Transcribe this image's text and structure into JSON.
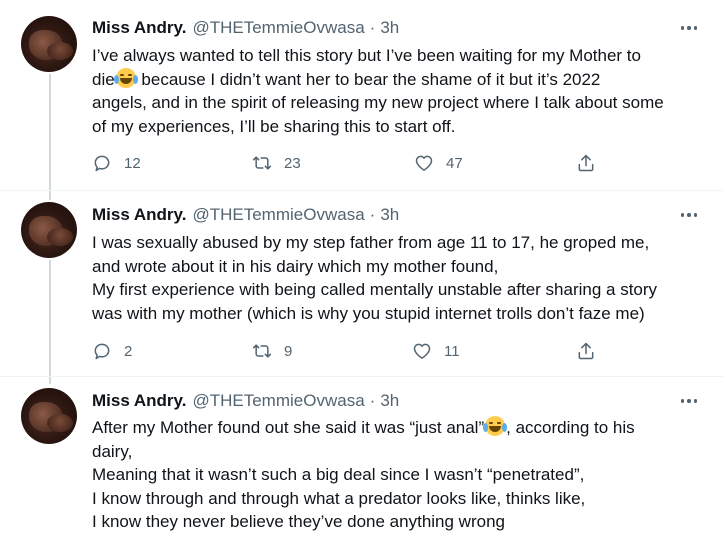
{
  "author": {
    "name": "Miss Andry.",
    "handle": "@THETemmieOvwasa",
    "separator": "·",
    "time": "3h"
  },
  "tweets": [
    {
      "lines": [
        "I’ve always wanted to tell this story but I’ve been waiting for my Mother to",
        "die",
        " because I didn’t want her to bear the shame of it but it’s 2022",
        "angels, and in the spirit of releasing my new project where I talk about some",
        "of my experiences, I’ll be sharing this to start off."
      ],
      "emoji": "face-with-tears-of-joy",
      "replies": "12",
      "retweets": "23",
      "likes": "47"
    },
    {
      "lines": [
        "I was sexually abused by my step father from age 11 to 17, he groped me,",
        "and wrote about it in his dairy which my mother found,",
        "My first experience with being called mentally unstable after sharing a story",
        "was with my mother (which is why you stupid internet trolls don’t faze me)"
      ],
      "replies": "2",
      "retweets": "9",
      "likes": "11"
    },
    {
      "lines": [
        "After my Mother found out she said it was “just anal”",
        ", according to his",
        "dairy,",
        "Meaning that it wasn’t such a big deal since I wasn’t “penetrated”,",
        "I know through and through what a predator looks like, thinks like,",
        "I know they never believe they’ve done anything wrong"
      ],
      "emoji": "face-with-tears-of-joy"
    }
  ],
  "icons": {
    "reply": "reply-icon",
    "retweet": "retweet-icon",
    "like": "heart-icon",
    "share": "share-icon",
    "more": "more-icon"
  },
  "colors": {
    "text": "#0f1419",
    "muted": "#536471",
    "thread_line": "#cfd9de",
    "divider": "#eff3f4"
  }
}
